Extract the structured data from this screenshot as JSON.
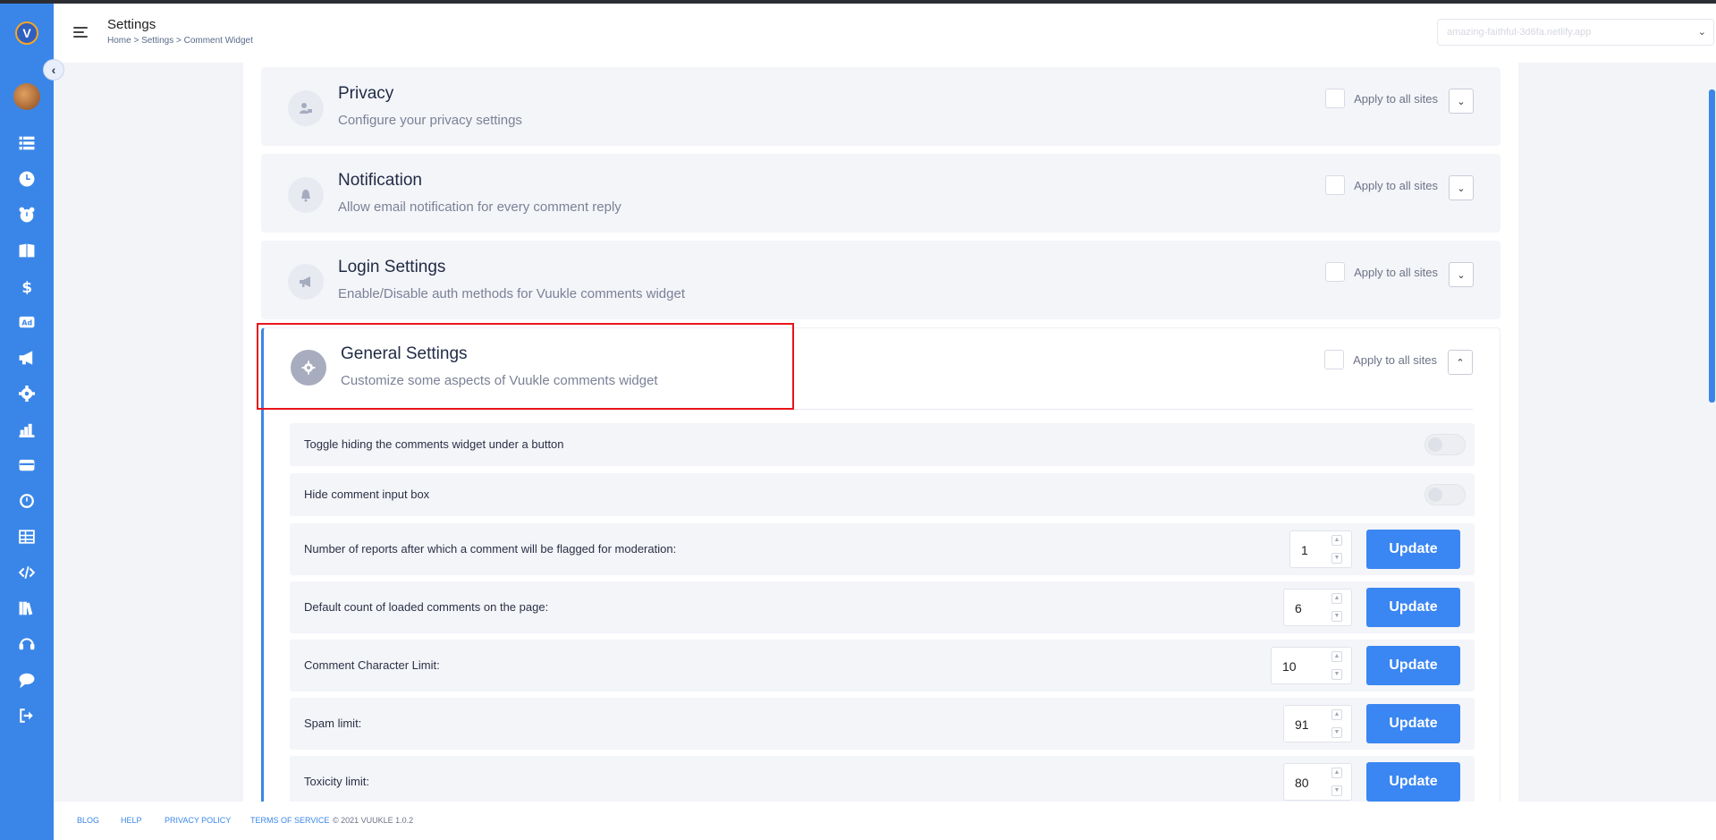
{
  "header": {
    "title": "Settings",
    "breadcrumb": "Home  > Settings > Comment Widget",
    "site_select": "amazing-faithful-3d6fa.netlify.app"
  },
  "sidebar": {
    "logo_letter": "V",
    "icons": [
      "list-icon",
      "clock-icon",
      "alarm-icon",
      "book-icon",
      "dollar-icon",
      "ad-icon",
      "megaphone-icon",
      "gear-icon",
      "chart-icon",
      "card-icon",
      "history-icon",
      "table-icon",
      "code-icon",
      "library-icon",
      "headset-icon",
      "chat-icon",
      "logout-icon"
    ]
  },
  "sections": [
    {
      "title": "Privacy",
      "subtitle": "Configure your privacy settings",
      "apply_label": "Apply to all sites",
      "icon": "user-lock-icon",
      "expanded": false
    },
    {
      "title": "Notification",
      "subtitle": "Allow email notification for every comment reply",
      "apply_label": "Apply to all sites",
      "icon": "bell-icon",
      "expanded": false
    },
    {
      "title": "Login Settings",
      "subtitle": "Enable/Disable auth methods for Vuukle comments widget",
      "apply_label": "Apply to all sites",
      "icon": "megaphone-icon",
      "expanded": false
    },
    {
      "title": "General Settings",
      "subtitle": "Customize some aspects of Vuukle comments widget",
      "apply_label": "Apply to all sites",
      "icon": "gear-icon",
      "expanded": true
    }
  ],
  "general": {
    "toggles": [
      {
        "label": "Toggle hiding the comments widget under a button",
        "on": false
      },
      {
        "label": "Hide comment input box",
        "on": false
      }
    ],
    "numbers": [
      {
        "label": "Number of reports after which a comment will be flagged for moderation:",
        "value": "1",
        "button": "Update"
      },
      {
        "label": "Default count of loaded comments on the page:",
        "value": "6",
        "button": "Update"
      },
      {
        "label": "Comment Character Limit:",
        "value": "10",
        "button": "Update"
      },
      {
        "label": "Spam limit:",
        "value": "91",
        "button": "Update"
      },
      {
        "label": "Toxicity limit:",
        "value": "80",
        "button": "Update"
      }
    ]
  },
  "footer": {
    "blog": "BLOG",
    "help": "HELP",
    "privacy": "PRIVACY POLICY",
    "terms": "TERMS OF SERVICE",
    "copyright": "© 2021 VUUKLE 1.0.2"
  },
  "colors": {
    "accent": "#3a86e8",
    "highlight": "#e8141b"
  }
}
